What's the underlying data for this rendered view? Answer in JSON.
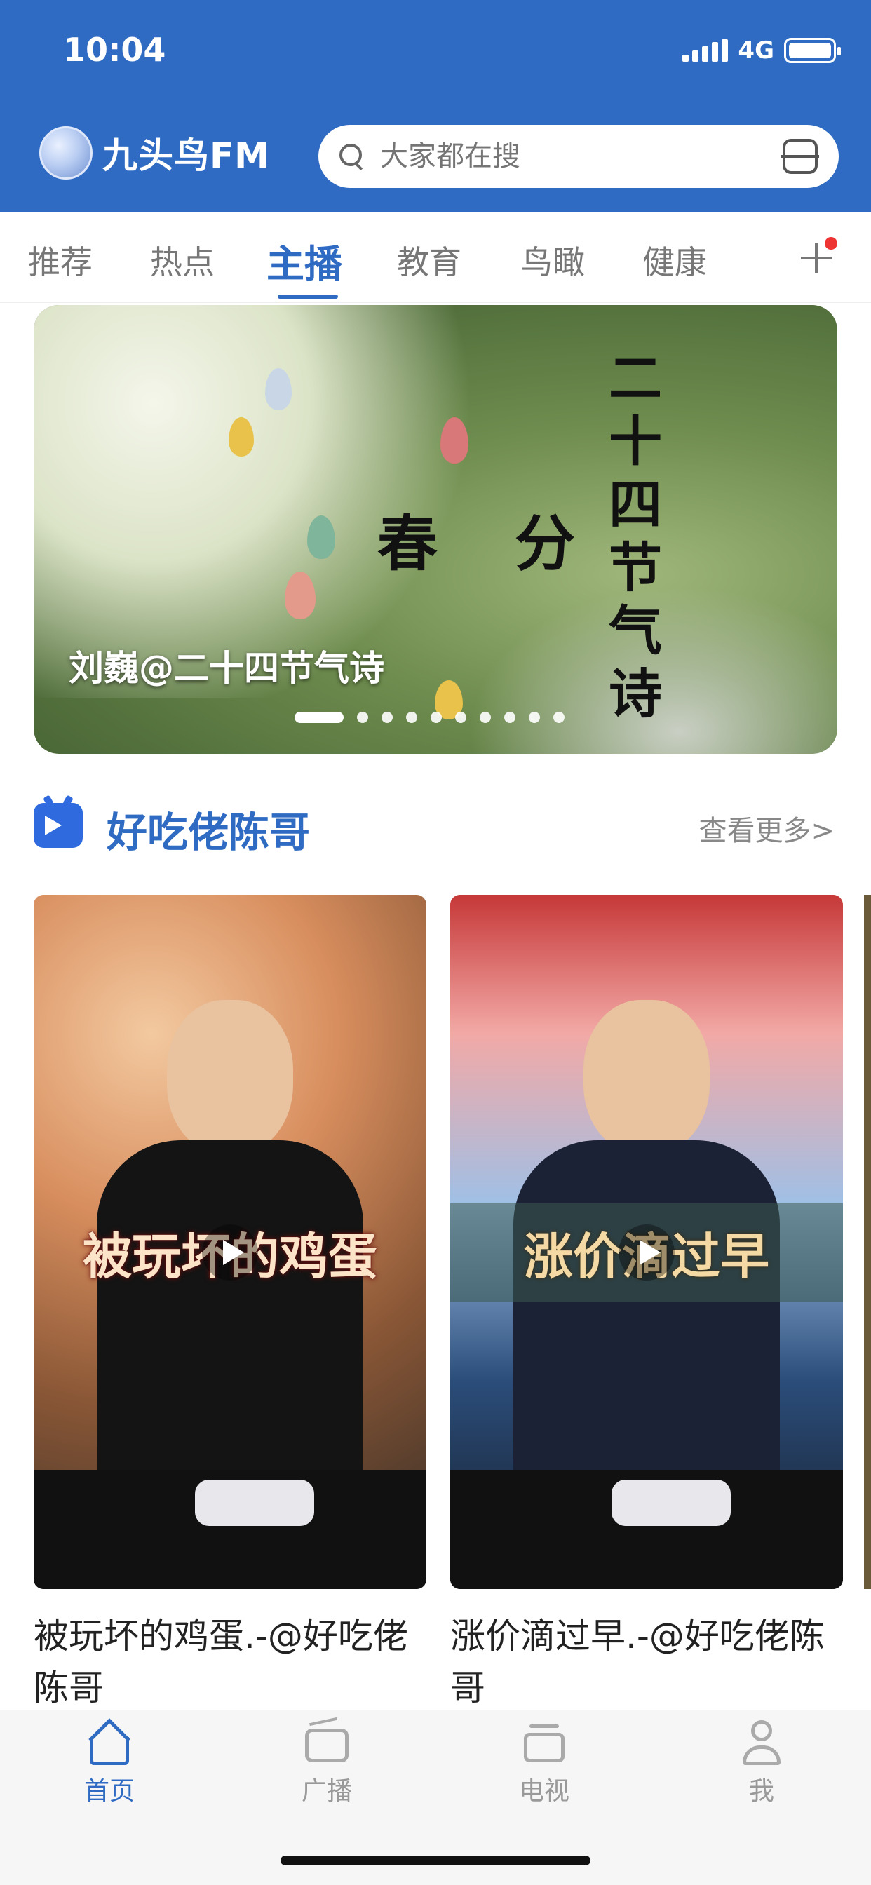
{
  "status_bar": {
    "time": "10:04",
    "network": "4G"
  },
  "header": {
    "app_name": "九头鸟FM",
    "search": {
      "placeholder": "大家都在搜"
    }
  },
  "tabs": [
    {
      "label": "推荐"
    },
    {
      "label": "热点"
    },
    {
      "label": "主播",
      "active": true
    },
    {
      "label": "教育"
    },
    {
      "label": "鸟瞰"
    },
    {
      "label": "健康"
    }
  ],
  "banner": {
    "title": "春 分",
    "vertical_text": "二十四节气诗",
    "caption": "刘巍@二十四节气诗",
    "dot_count": 10,
    "active_dot": 0
  },
  "section": {
    "title": "好吃佬陈哥",
    "more_label": "查看更多>"
  },
  "cards": [
    {
      "thumb_text": "被玩坏的鸡蛋",
      "title": "被玩坏的鸡蛋.-@好吃佬陈哥"
    },
    {
      "thumb_text": "涨价滴过早",
      "title": "涨价滴过早.-@好吃佬陈哥"
    }
  ],
  "bottom_nav": [
    {
      "label": "首页",
      "icon": "home-icon",
      "active": true
    },
    {
      "label": "广播",
      "icon": "radio-icon"
    },
    {
      "label": "电视",
      "icon": "tv-icon"
    },
    {
      "label": "我",
      "icon": "profile-icon"
    }
  ],
  "colors": {
    "brand_blue": "#2f6bc2",
    "badge_red": "#e33333"
  }
}
